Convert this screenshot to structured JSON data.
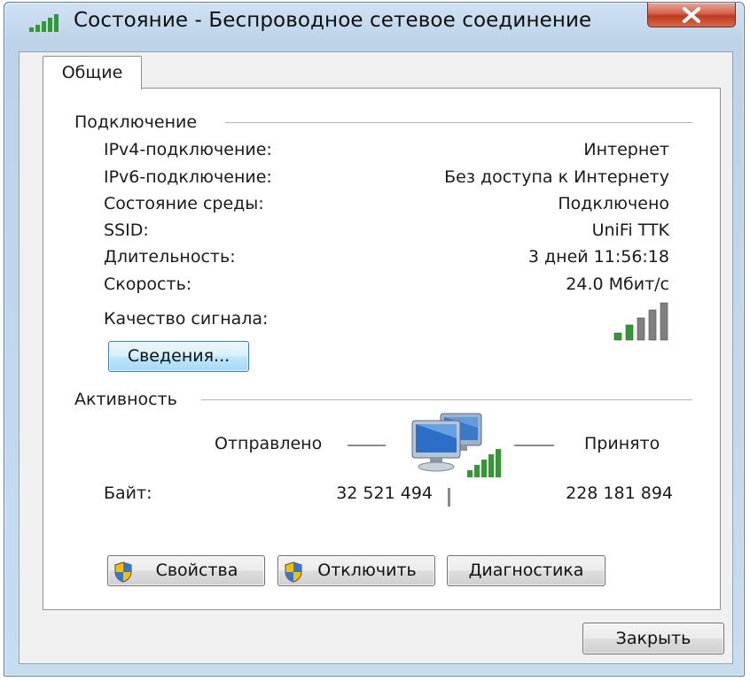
{
  "window": {
    "title": "Состояние - Беспроводное сетевое соединение"
  },
  "tabs": [
    {
      "label": "Общие",
      "selected": true
    }
  ],
  "connection": {
    "section_title": "Подключение",
    "rows": [
      {
        "label": "IPv4-подключение:",
        "value": "Интернет"
      },
      {
        "label": "IPv6-подключение:",
        "value": "Без доступа к Интернету"
      },
      {
        "label": "Состояние среды:",
        "value": "Подключено"
      },
      {
        "label": "SSID:",
        "value": "UniFi TTK"
      },
      {
        "label": "Длительность:",
        "value": "3 дней 11:56:18"
      },
      {
        "label": "Скорость:",
        "value": "24.0 Мбит/с"
      }
    ],
    "signal_label": "Качество сигнала:",
    "signal_bars_lit": 2,
    "signal_bars_total": 5,
    "details_button": "Сведения..."
  },
  "activity": {
    "section_title": "Активность",
    "sent_label": "Отправлено",
    "received_label": "Принято",
    "bytes_label": "Байт:",
    "bytes_sent": "32 521 494",
    "bytes_received": "228 181 894"
  },
  "buttons": {
    "properties": "Свойства",
    "disable": "Отключить",
    "diagnose": "Диагностика",
    "close": "Закрыть"
  },
  "colors": {
    "signal_lit": "#2f9a2f",
    "signal_unlit": "#808080",
    "close_button": "#c7432a",
    "window_frame": "#c7dcef"
  },
  "icons": {
    "title": "wireless-signal-icon",
    "activity": "network-computers-icon",
    "shield": "uac-shield-icon"
  }
}
